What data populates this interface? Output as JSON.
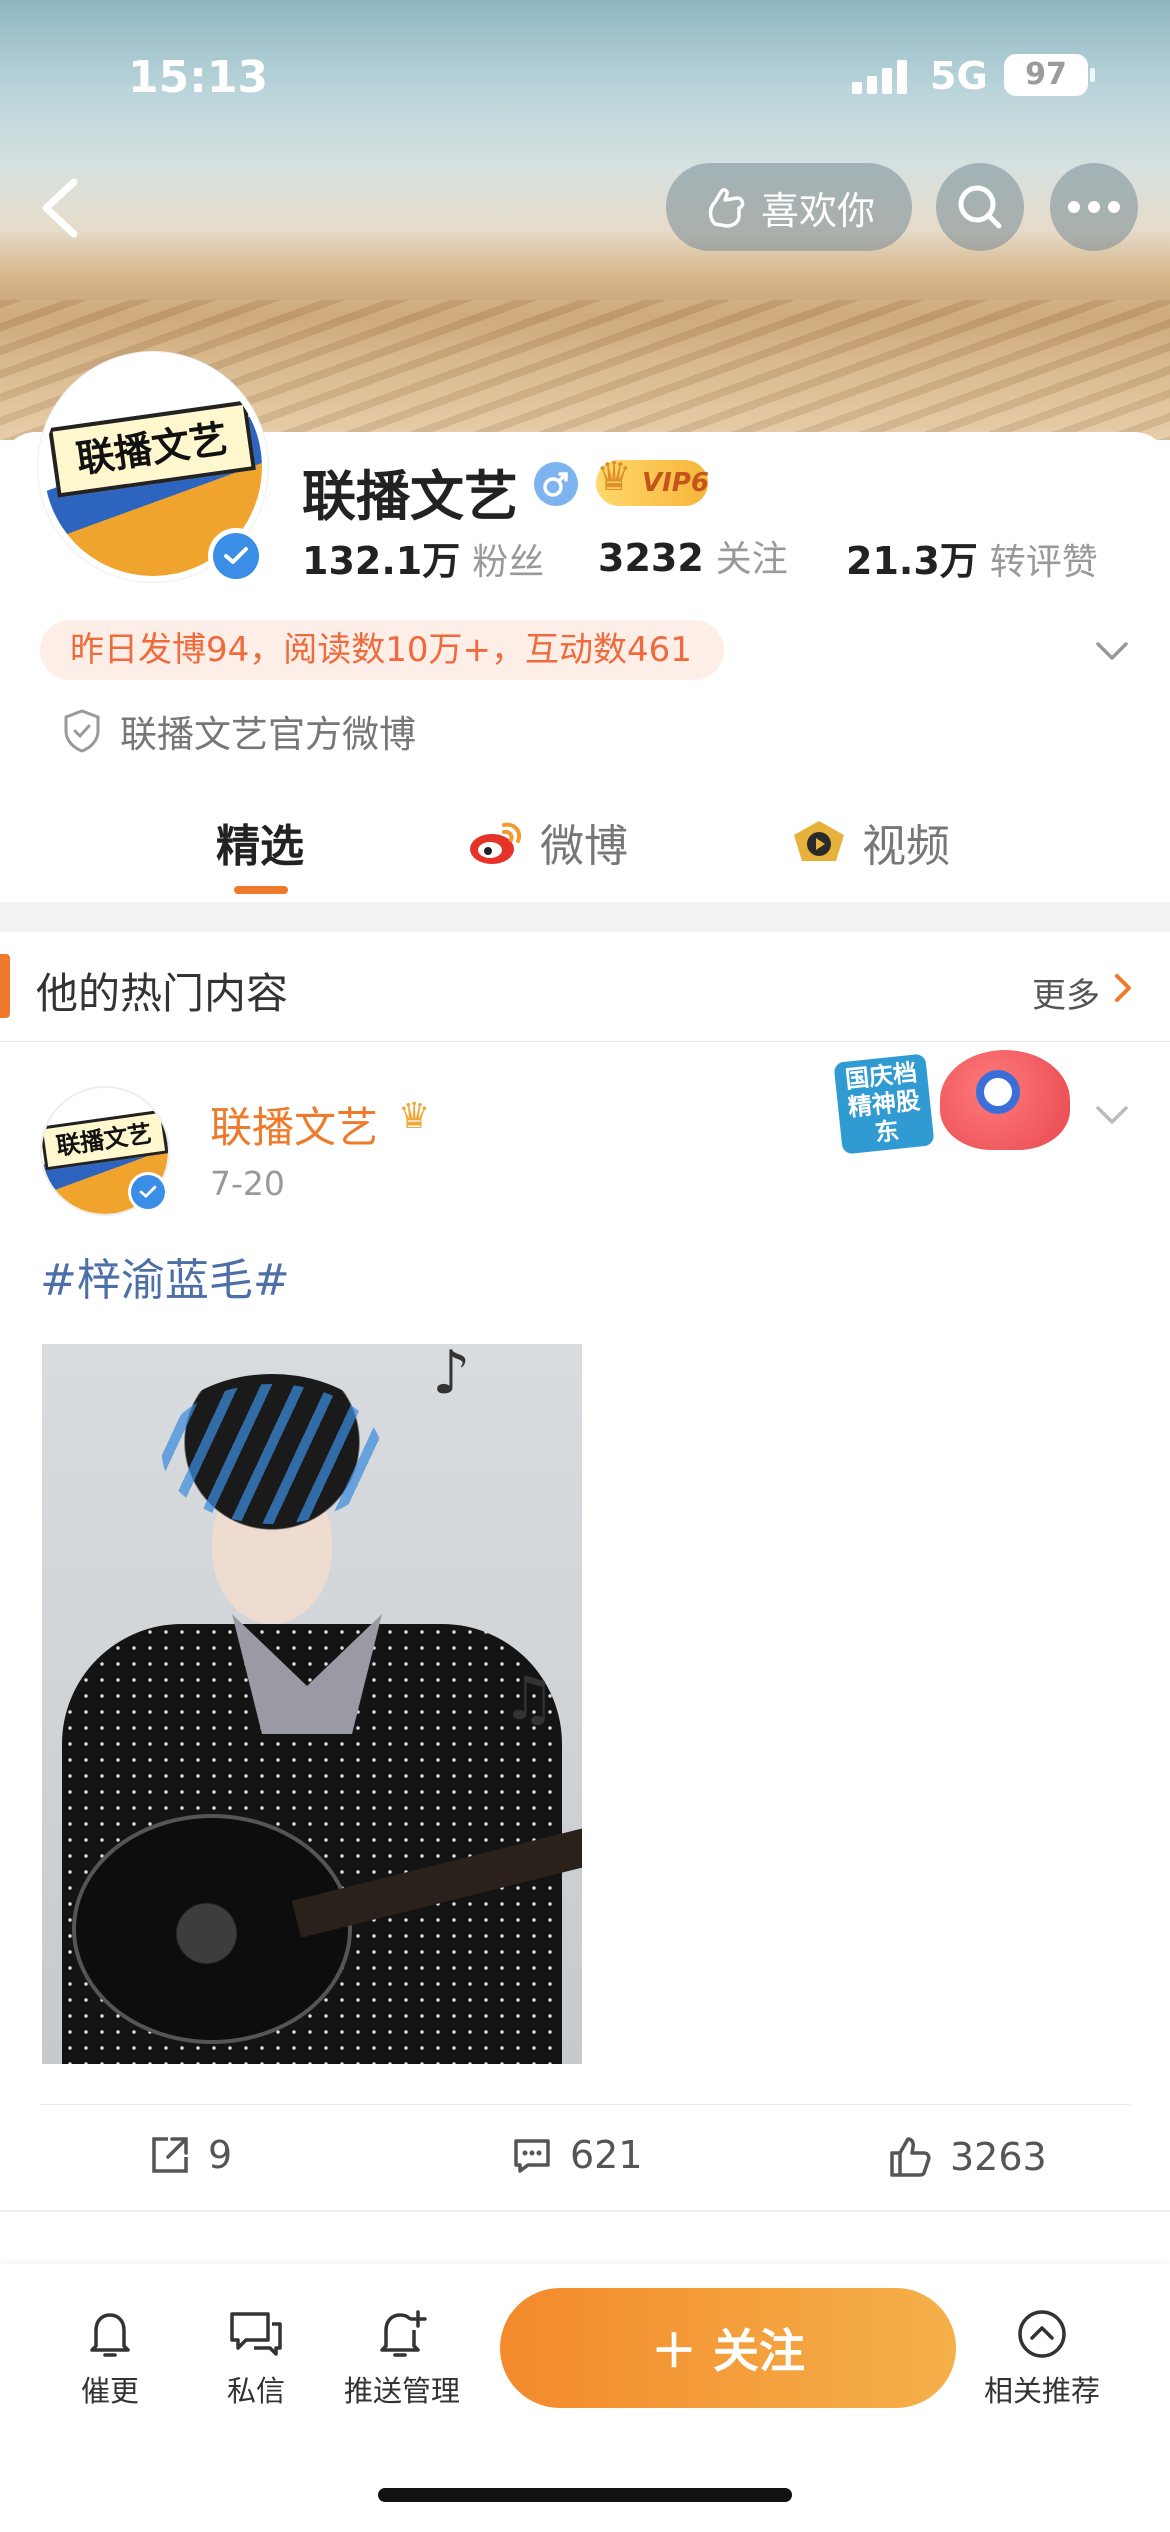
{
  "status_bar": {
    "time": "15:13",
    "network": "5G",
    "battery": "97"
  },
  "header": {
    "like_label": "喜欢你"
  },
  "profile": {
    "name": "联播文艺",
    "vip_label": "VIP6",
    "avatar_text": "联播文艺",
    "followers_value": "132.1万",
    "followers_label": "粉丝",
    "following_value": "3232",
    "following_label": "关注",
    "engagement_value": "21.3万",
    "engagement_label": "转评赞",
    "summary": "昨日发博94，阅读数10万+，互动数461",
    "official": "联播文艺官方微博"
  },
  "tabs": [
    {
      "label": "精选",
      "active": true
    },
    {
      "label": "微博",
      "active": false
    },
    {
      "label": "视频",
      "active": false
    }
  ],
  "section": {
    "title": "他的热门内容",
    "more": "更多"
  },
  "post": {
    "author": "联播文艺",
    "date": "7-20",
    "tag": "#梓渝蓝毛#",
    "sticker_text": "国庆档精神股东",
    "reposts": "9",
    "comments": "621",
    "likes": "3263"
  },
  "bottom_bar": {
    "remind": "催更",
    "message": "私信",
    "push": "推送管理",
    "follow": "关注",
    "related": "相关推荐"
  },
  "colors": {
    "accent": "#f07a2b",
    "verified": "#3a8ee6",
    "tag": "#4d6fa8"
  }
}
